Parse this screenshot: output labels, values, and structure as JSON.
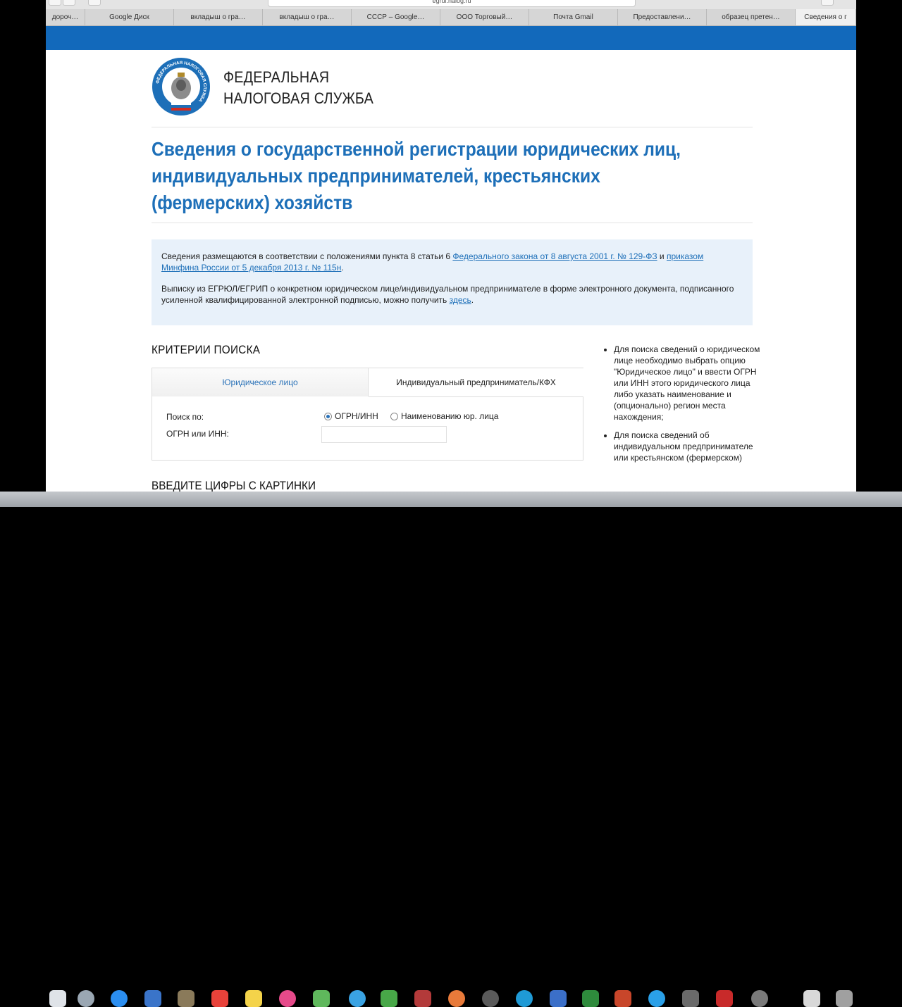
{
  "browser": {
    "address": "egrul.nalog.ru",
    "tabs": [
      "дороч…",
      "Google Диск",
      "вкладыш о гра…",
      "вкладыш о гра…",
      "СССР – Google…",
      "ООО Торговый…",
      "Почта Gmail",
      "Предоставлени…",
      "образец претен…",
      "Сведения о г"
    ]
  },
  "header": {
    "org_line1": "ФЕДЕРАЛЬНАЯ",
    "org_line2": "НАЛОГОВАЯ СЛУЖБА",
    "logo_text": "ФЕДЕРАЛЬНАЯ НАЛОГОВАЯ СЛУЖБА"
  },
  "title": "Сведения о государственной регистрации юридических лиц, индивидуальных предпринимателей, крестьянских (фермерских) хозяйств",
  "info": {
    "p1_text": "Сведения размещаются в соответствии с положениями пункта 8 статьи 6 ",
    "p1_link1": "Федерального закона от 8 августа 2001 г. № 129-ФЗ",
    "p1_and": " и ",
    "p1_link2": "приказом Минфина России от 5 декабря 2013 г. № 115н",
    "p1_end": ".",
    "p2_text": "Выписку из ЕГРЮЛ/ЕГРИП о конкретном юридическом лице/индивидуальном предпринимателе в форме электронного документа, подписанного усиленной квалифицированной электронной подписью, можно получить ",
    "p2_link": "здесь",
    "p2_end": "."
  },
  "criteria": {
    "title": "КРИТЕРИИ ПОИСКА",
    "tab_legal": "Юридическое лицо",
    "tab_ip": "Индивидуальный предприниматель/КФХ",
    "search_by_label": "Поиск по:",
    "radio_ogrn": "ОГРН/ИНН",
    "radio_name": "Наименованию юр. лица",
    "ogrn_label": "ОГРН или ИНН:",
    "ogrn_value": "",
    "captcha_title": "ВВЕДИТЕ ЦИФРЫ С КАРТИНКИ"
  },
  "help": [
    "Для поиска сведений о юридическом лице необходимо выбрать опцию \"Юридическое лицо\" и ввести ОГРН или ИНН этого юридического лица либо указать наименование и (опционально) регион места нахождения;",
    "Для поиска сведений об индивидуальном предпринимателе или крестьянском (фермерском)"
  ],
  "colors": {
    "accent_blue": "#1269bb",
    "title_blue": "#1d6fb8",
    "info_bg": "#e8f1fa"
  }
}
